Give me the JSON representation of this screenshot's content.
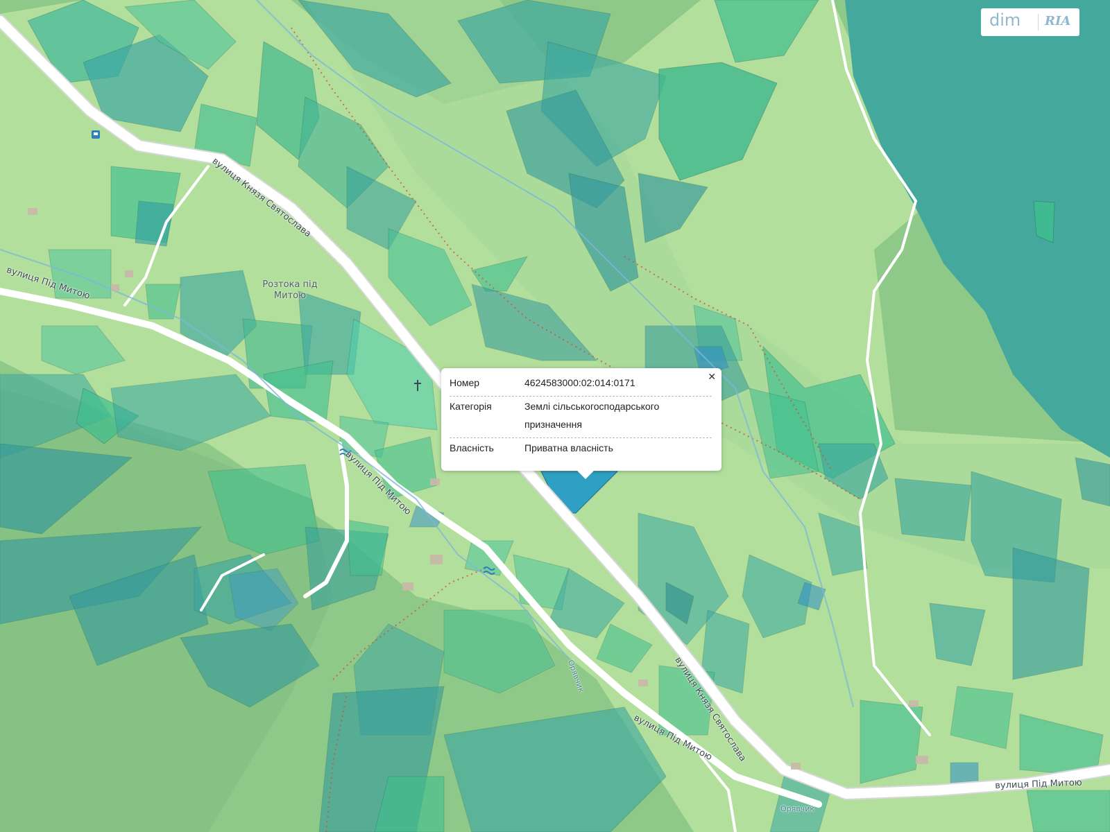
{
  "brand": {
    "dim": "dim",
    "ria": "RIA"
  },
  "map": {
    "streets": [
      "вулиця Князя Святослава",
      "вулиця Під Митою",
      "вулиця Під Митою",
      "вулиця Князя Святослава",
      "вулиця Під Митою",
      "вулиця Під Митою"
    ],
    "places": [
      "Розтока під\nМитою"
    ],
    "water": [
      "Орявчик",
      "Орявчик"
    ],
    "colors": {
      "forest": "#8fc98a",
      "meadow": "#b8e39f",
      "lake": "#45a89c",
      "parcel": "#3fbf9a",
      "selected": "#2f9fc4",
      "road": "#ffffff",
      "trail": "#d0533a"
    },
    "popup": {
      "close_icon": "close-icon",
      "rows": [
        {
          "key": "Номер",
          "value": "4624583000:02:014:0171"
        },
        {
          "key": "Категорія",
          "value": "Землі сільськогосподарського",
          "value2": "призначення"
        },
        {
          "key": "Власність",
          "value": "Приватна власність"
        }
      ]
    }
  }
}
